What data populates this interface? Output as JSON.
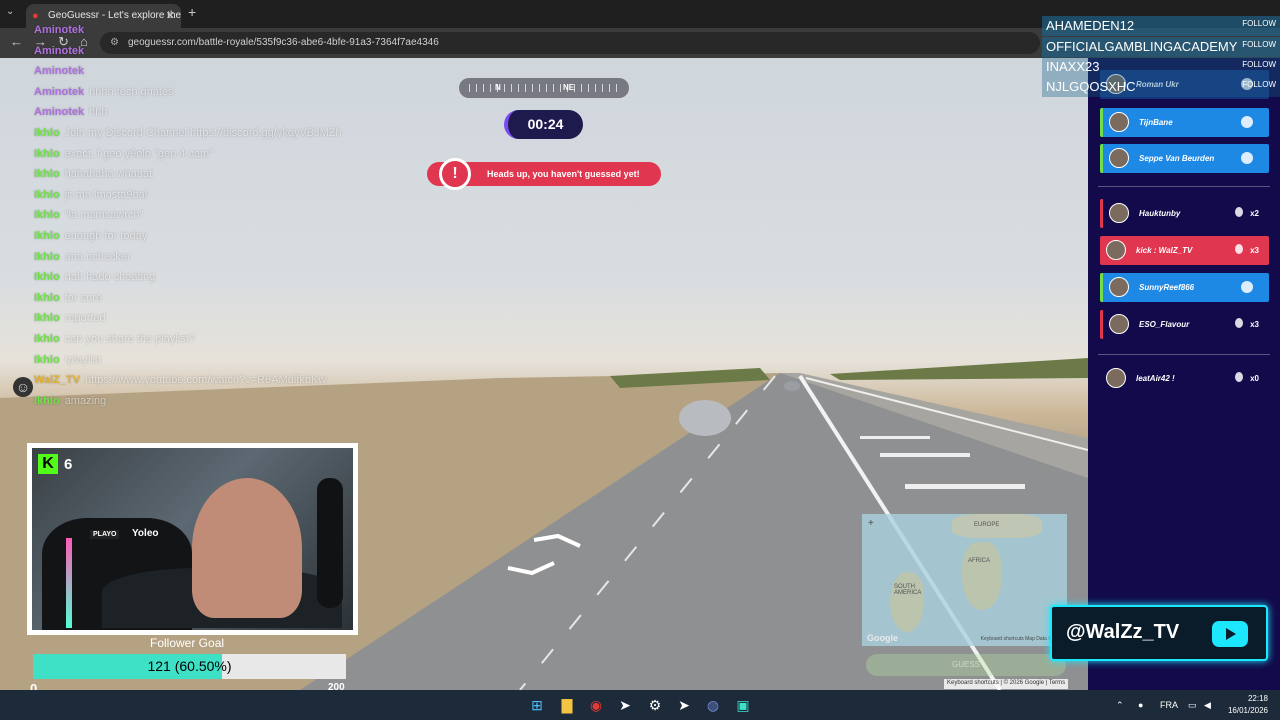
{
  "browser": {
    "tab_title": "GeoGuessr - Let's explore the w",
    "url": "geoguessr.com/battle-royale/535f9c36-abe6-4bfe-91a3-7364f7ae4346"
  },
  "game": {
    "compass_n": "N",
    "compass_ne": "NE",
    "timer": "00:24",
    "alert_icon": "!",
    "alert_text": "Heads up, you haven't guessed yet!",
    "map_labels": [
      "EUROPE",
      "AFRICA",
      "SOUTH AMERICA"
    ],
    "map_logo": "Google",
    "map_attrib": "Keyboard shortcuts   Map Data ©2026",
    "guess_button": "GUESS",
    "footer": "Keyboard shortcuts | © 2026 Google | Terms"
  },
  "chat": [
    {
      "user": "Aminotek",
      "color": "#b070e0",
      "msg": ""
    },
    {
      "user": "Aminotek",
      "color": "#b070e0",
      "msg": ""
    },
    {
      "user": "Aminotek",
      "color": "#b070e0",
      "msg": ""
    },
    {
      "user": "Aminotek",
      "color": "#b070e0",
      "msg": "hhhh fech ghates"
    },
    {
      "user": "Aminotek",
      "color": "#b070e0",
      "msg": "hhh"
    },
    {
      "user": "Ikhlo",
      "color": "#6fe04a",
      "msg": "Join my Discord Channel https://discord.gg/ykqyVBJMZh"
    },
    {
      "user": "Ikhlo",
      "color": "#6fe04a",
      "msg": "exact. f geo y9olo \"gen 4 cam\""
    },
    {
      "user": "Ikhlo",
      "color": "#6fe04a",
      "msg": "hahahaha whaaat"
    },
    {
      "user": "Ikhlo",
      "color": "#6fe04a",
      "msg": "jit mn lmosta9bal"
    },
    {
      "user": "Ikhlo",
      "color": "#6fe04a",
      "msg": "\"la mamsawrch\""
    },
    {
      "user": "Ikhlo",
      "color": "#6fe04a",
      "msg": "enough for today"
    },
    {
      "user": "Ikhlo",
      "color": "#6fe04a",
      "msg": "ana nchecker"
    },
    {
      "user": "Ikhlo",
      "color": "#6fe04a",
      "msg": "nah hado cheating"
    },
    {
      "user": "Ikhlo",
      "color": "#6fe04a",
      "msg": "for sure"
    },
    {
      "user": "Ikhlo",
      "color": "#6fe04a",
      "msg": "reported"
    },
    {
      "user": "Ikhlo",
      "color": "#6fe04a",
      "msg": "can you share the playlist?"
    },
    {
      "user": "Ikhlo",
      "color": "#6fe04a",
      "msg": "!playlist"
    },
    {
      "user": "WalZ_TV",
      "color": "#e0b030",
      "msg": "https://www.youtube.com/watch?v=R6AMdlfkbKw"
    },
    {
      "user": "Ikhlo",
      "color": "#6fe04a",
      "msg": "amazing"
    }
  ],
  "webcam": {
    "kick_count": "6",
    "chair_label": "Yoleo",
    "chair_brand": "PLAYO"
  },
  "follower_goal": {
    "title": "Follower Goal",
    "label": "121 (60.50%)",
    "progress": 0.605,
    "min": "0",
    "max": "200"
  },
  "players": [
    {
      "name": "Roman Ukr",
      "style": "faded",
      "right": ""
    },
    {
      "name": "TijnBane",
      "style": "blue",
      "right": ""
    },
    {
      "name": "Seppe Van Beurden",
      "style": "blue",
      "right": ""
    },
    {
      "name": "Hauktunby",
      "style": "red-outline",
      "right": "x2"
    },
    {
      "name": "kick : WalZ_TV",
      "style": "red",
      "right": "x3"
    },
    {
      "name": "SunnyReef866",
      "style": "blue",
      "right": ""
    },
    {
      "name": "ESO_Flavour",
      "style": "red-outline",
      "right": "x3"
    },
    {
      "name": "leatAir42 !",
      "style": "plain",
      "right": "x0"
    }
  ],
  "alerts": [
    {
      "name": "AHAMEDEN12",
      "follow": "FOLLOW"
    },
    {
      "name": "OFFICIALGAMBLINGACADEMY",
      "follow": "FOLLOW"
    },
    {
      "name": "INAXX23",
      "follow": "FOLLOW"
    },
    {
      "name": "NJLGQOSXHC",
      "follow": "FOLLOW"
    }
  ],
  "brand": {
    "handle": "@WalZz_TV"
  },
  "taskbar": {
    "lang": "FRA",
    "time": "22:18",
    "date": "16/01/2026"
  },
  "colors": {
    "panel_bg": "#120a4a",
    "player_blue": "#1e88e5",
    "player_red": "#e0364f",
    "timer_bg": "#1d1a4d",
    "accent_cyan": "#1de7ff"
  }
}
